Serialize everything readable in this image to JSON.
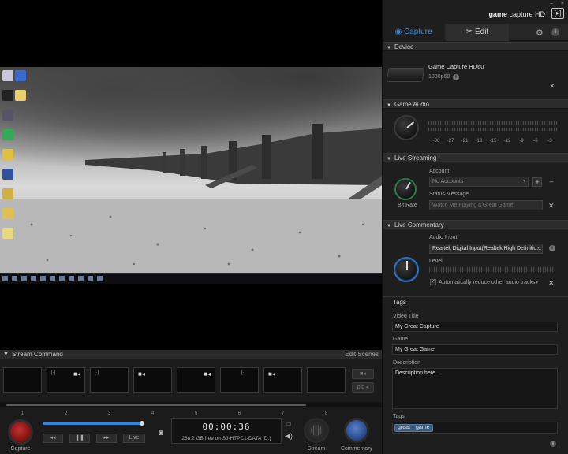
{
  "panel": {
    "brand": {
      "prefix": "game",
      "text": "capture HD",
      "logo": "[▸]"
    },
    "window": {
      "minimize": "–",
      "close": "×"
    },
    "tabs": {
      "capture": "Capture",
      "edit": "Edit"
    },
    "device": {
      "header": "Device",
      "name": "Game Capture HD60",
      "resolution": "1080p60"
    },
    "audio": {
      "header": "Game Audio",
      "ticks": [
        "-36",
        "-27",
        "-21",
        "-18",
        "-15",
        "-12",
        "-9",
        "-6",
        "-3"
      ]
    },
    "live_streaming": {
      "header": "Live Streaming",
      "account_label": "Account",
      "account_value": "No Accounts",
      "status_label": "Status Message",
      "status_placeholder": "Watch Me Playing a Great Game",
      "knob_label": "Bit Rate",
      "add": "+",
      "remove": "–"
    },
    "live_commentary": {
      "header": "Live Commentary",
      "input_label": "Audio Input",
      "input_value": "Realtek Digital Input(Realtek High Definitio...",
      "level_label": "Level",
      "reduce_label": "Automatically reduce other audio tracks",
      "check": "✓"
    },
    "tags": {
      "header": "Tags",
      "video_title_label": "Video Title",
      "video_title": "My Great Capture",
      "game_label": "Game",
      "game": "My Great Game",
      "description_label": "Description",
      "description": "Description here.",
      "tags_label": "Tags",
      "chips": [
        "great",
        "game"
      ]
    }
  },
  "stream_command": {
    "header": "Stream Command",
    "edit_scenes": "Edit Scenes",
    "scene_numbers": [
      "1",
      "2",
      "3",
      "4",
      "5",
      "6",
      "7",
      "8"
    ],
    "side_buttons": [
      "■◂",
      "pic ◂"
    ]
  },
  "controls": {
    "capture_label": "Capture",
    "stream_label": "Stream",
    "commentary_label": "Commentary",
    "rewind": "◂◂",
    "pause": "❚❚",
    "forward": "▸▸",
    "live": "Live",
    "timer": "00:00:36",
    "disk_free": "268.2 GB free on SJ-HTPC1-DATA (D:)",
    "progress_fraction": 0.97
  },
  "icons": {
    "gear": "⚙",
    "info": "i",
    "tool": "✕",
    "camera": "◙",
    "speaker": "◀)",
    "monitor": "▭",
    "triangle": "▼",
    "caret": "▾",
    "video_cam": "■◂",
    "scene_small": "[·]"
  },
  "colors": {
    "accent": "#3b8fe6",
    "record": "#c43030",
    "commentary": "#3d6ab8"
  }
}
